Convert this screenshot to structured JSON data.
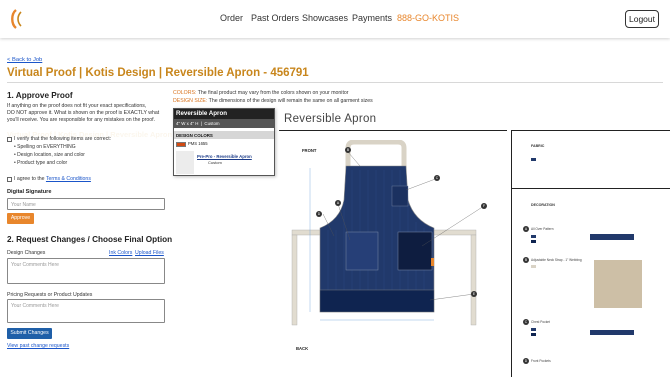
{
  "header": {
    "nav": [
      "Order",
      "Past Orders",
      "Showcases",
      "Payments"
    ],
    "phone": "888-GO-KOTIS",
    "logout": "Logout"
  },
  "breadcrumb": {
    "back": "< Back to Job"
  },
  "page_title": "Virtual Proof | Kotis Design | Reversible Apron - 456791",
  "approve": {
    "heading": "1. Approve Proof",
    "intro": [
      "If anything on the proof does not fit your exact specifications,",
      "DO NOT approve it. What is shown on the proof is EXACTLY what",
      "you'll receive. You are responsible for any mistakes on the proof."
    ],
    "verify_label": "I verify that the following items are correct:",
    "items": [
      "Spelling on EVERYTHING",
      "Design location, size and color",
      "Product type and color"
    ],
    "agree_prefix": "I agree to the",
    "terms_link": "Terms & Conditions",
    "signature_label": "Digital Signature",
    "signature_placeholder": "Your Name",
    "approve_button": "Approve"
  },
  "changes": {
    "heading": "2. Request Changes / Choose Final Option",
    "design_label": "Design Changes",
    "ink_colors": "Ink Colors",
    "upload_files": "Upload Files",
    "design_placeholder": "Your Comments Here",
    "pricing_label": "Pricing Requests or Product Updates",
    "pricing_placeholder": "Your Comments Here",
    "submit_button": "Submit Changes",
    "view_past": "View past change requests"
  },
  "notes": {
    "colors_label": "COLORS:",
    "colors_text": "The final product may vary from the colors shown on your monitor",
    "size_label": "DESIGN SIZE:",
    "size_text": "The dimensions of the design will remain the same on all garment sizes"
  },
  "popover": {
    "title": "Reversible Apron",
    "dims": "4\" W x 4\" H",
    "custom": "Custom",
    "section": "DESIGN COLORS",
    "pms": "PMS 1655",
    "item_title": "Pre-Pro - Reversible Apron",
    "item_sub": "Custom"
  },
  "proof": {
    "title": "Reversible Apron",
    "front_label": "FRONT",
    "back_label": "BACK",
    "fabric_head": "FABRIC",
    "decoration_head": "DECORATION",
    "callouts": [
      "A",
      "B",
      "C",
      "D",
      "E",
      "F"
    ],
    "side": [
      {
        "id": "A",
        "title": "All Over Pattern"
      },
      {
        "id": "B",
        "title": "Adjustable Neck Strap - 1\" Webbing"
      },
      {
        "id": "C",
        "title": "Chest Pocket"
      },
      {
        "id": "D",
        "title": "Front Pockets"
      }
    ]
  },
  "colors": {
    "accent": "#e8862c",
    "title": "#c8861c",
    "link": "#1a55c9",
    "navy": "#21396b",
    "dark_navy": "#0f2450",
    "strap": "#d9d3c6"
  }
}
